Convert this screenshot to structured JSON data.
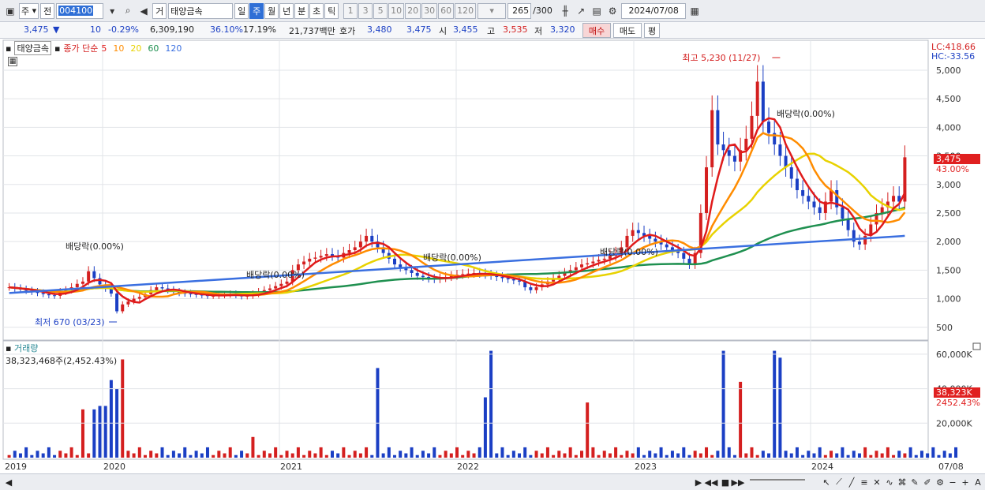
{
  "toolbar": {
    "type_value": "주",
    "prev_label": "전",
    "code": "004100",
    "market_label": "거",
    "name": "태양금속",
    "period_tabs": [
      {
        "label": "일",
        "selected": false
      },
      {
        "label": "주",
        "selected": true
      },
      {
        "label": "월",
        "selected": false
      },
      {
        "label": "년",
        "selected": false
      },
      {
        "label": "분",
        "selected": false
      },
      {
        "label": "초",
        "selected": false
      },
      {
        "label": "틱",
        "selected": false
      }
    ],
    "intervals": [
      "1",
      "3",
      "5",
      "10",
      "20",
      "30",
      "60",
      "120"
    ],
    "count": "265",
    "count_total": "/300",
    "date": "2024/07/08"
  },
  "quote": {
    "price": "3,475",
    "arrow": "▼",
    "change": "10",
    "change_pct": "-0.29%",
    "volume": "6,309,190",
    "ratio1": "36.10%",
    "ratio2": "17.19%",
    "amount": "21,737백만",
    "bid_label": "호가",
    "bid": "3,480",
    "ask": "3,475",
    "open_label": "시",
    "open": "3,455",
    "high_label": "고",
    "high": "3,535",
    "low_label": "저",
    "low": "3,320",
    "buy_label": "매수",
    "sell_label": "매도",
    "eval_label": "평"
  },
  "legend": {
    "name": "태양금속",
    "ma_label": "종가 단순",
    "mas": [
      {
        "period": "5",
        "color": "#e01b1b"
      },
      {
        "period": "10",
        "color": "#ff8c00"
      },
      {
        "period": "20",
        "color": "#e8d200"
      },
      {
        "period": "60",
        "color": "#1f9050"
      },
      {
        "period": "120",
        "color": "#3a6fe0"
      }
    ],
    "lc": "LC:418.66",
    "hc": "HC:-33.56"
  },
  "annotations": {
    "high": "최고 5,230 (11/27)",
    "low": "최저 670 (03/23)",
    "dividends": [
      "배당락(0.00%)",
      "배당락(0.00%)",
      "배당락(0.00%)",
      "배당락(0.00%)",
      "배당락(0.00%)"
    ]
  },
  "price_axis": [
    "5,000",
    "4,500",
    "4,000",
    "3,500",
    "3,000",
    "2,500",
    "2,000",
    "1,500",
    "1,000",
    "500"
  ],
  "price_tag": {
    "value": "3,475",
    "pct": "43.00%"
  },
  "volume": {
    "label": "거래량",
    "summary": "38,323,468주(2,452.43%)",
    "axis": [
      "60,000K",
      "40,000K",
      "20,000K"
    ],
    "tag_value": "38,323K",
    "tag_pct": "2452.43%"
  },
  "x_axis": [
    "2019",
    "2020",
    "2021",
    "2022",
    "2023",
    "2024",
    "07/08"
  ],
  "chart_data": {
    "type": "candlestick",
    "unit": "KRW (weekly)",
    "ylim": [
      400,
      5400
    ],
    "close": [
      1200,
      1180,
      1160,
      1140,
      1120,
      1100,
      1080,
      1060,
      1050,
      1120,
      1150,
      1200,
      1260,
      1300,
      1480,
      1360,
      1250,
      1180,
      1090,
      780,
      900,
      950,
      1000,
      1030,
      1080,
      1150,
      1200,
      1180,
      1150,
      1120,
      1100,
      1090,
      1080,
      1070,
      1060,
      1050,
      1050,
      1060,
      1070,
      1080,
      1060,
      1040,
      1050,
      1080,
      1120,
      1150,
      1180,
      1220,
      1260,
      1300,
      1500,
      1600,
      1650,
      1700,
      1720,
      1750,
      1780,
      1750,
      1720,
      1800,
      1850,
      1900,
      2000,
      2100,
      2000,
      1900,
      1800,
      1700,
      1600,
      1550,
      1500,
      1450,
      1400,
      1380,
      1350,
      1340,
      1360,
      1380,
      1400,
      1420,
      1430,
      1440,
      1450,
      1440,
      1420,
      1400,
      1380,
      1360,
      1340,
      1320,
      1300,
      1200,
      1150,
      1200,
      1250,
      1300,
      1350,
      1400,
      1450,
      1500,
      1550,
      1600,
      1620,
      1650,
      1680,
      1700,
      1750,
      1800,
      1900,
      2100,
      2200,
      2150,
      2100,
      2050,
      2000,
      1950,
      1900,
      1850,
      1800,
      1700,
      1600,
      1800,
      2500,
      3300,
      4300,
      3700,
      3600,
      3500,
      3400,
      3600,
      3800,
      4200,
      4800,
      4100,
      3900,
      3700,
      3500,
      3300,
      3100,
      2900,
      2800,
      2700,
      2600,
      2500,
      2700,
      2900,
      2600,
      2400,
      2200,
      2000,
      1950,
      2100,
      2300,
      2500,
      2600,
      2700,
      2800,
      2700,
      3475
    ],
    "volume_k": [
      1,
      1,
      1,
      1,
      1,
      1,
      1,
      1,
      1,
      1,
      1,
      1,
      1,
      1,
      1,
      1,
      1,
      1,
      1,
      1,
      1,
      1,
      1,
      1,
      1,
      1,
      1,
      1,
      1,
      1,
      1,
      1,
      1,
      1,
      1,
      1,
      1,
      1,
      1,
      1,
      1,
      1,
      1,
      1,
      1,
      1,
      1,
      1,
      1,
      1,
      1,
      1,
      1,
      1,
      1,
      1,
      1,
      1,
      1,
      1,
      1,
      1,
      1,
      1,
      1,
      1,
      1,
      1,
      1,
      1,
      1,
      1,
      1,
      1,
      1,
      1,
      1,
      1,
      1,
      1,
      1,
      1,
      1,
      1,
      1,
      1,
      1,
      1,
      1,
      1,
      1,
      1,
      1,
      1,
      1,
      1,
      1,
      1,
      1,
      1,
      1,
      1,
      1,
      1,
      1,
      1,
      1,
      1,
      1,
      1,
      1,
      1,
      1,
      1,
      1,
      1,
      1,
      1,
      1,
      1,
      1,
      1,
      1,
      1,
      1,
      1,
      1,
      1,
      1,
      1,
      1,
      1,
      1,
      1,
      1,
      1,
      1,
      1,
      1,
      1,
      1,
      1,
      1,
      1,
      1,
      1,
      1,
      1,
      1,
      1,
      1,
      1,
      1,
      1,
      1,
      1,
      1,
      1,
      1,
      1,
      1,
      1,
      1,
      1,
      1,
      1,
      1,
      38323
    ],
    "ma_lines": [
      "MA5",
      "MA10",
      "MA20",
      "MA60",
      "MA120"
    ],
    "ma120_start": 1100,
    "ma120_end": 2100
  }
}
